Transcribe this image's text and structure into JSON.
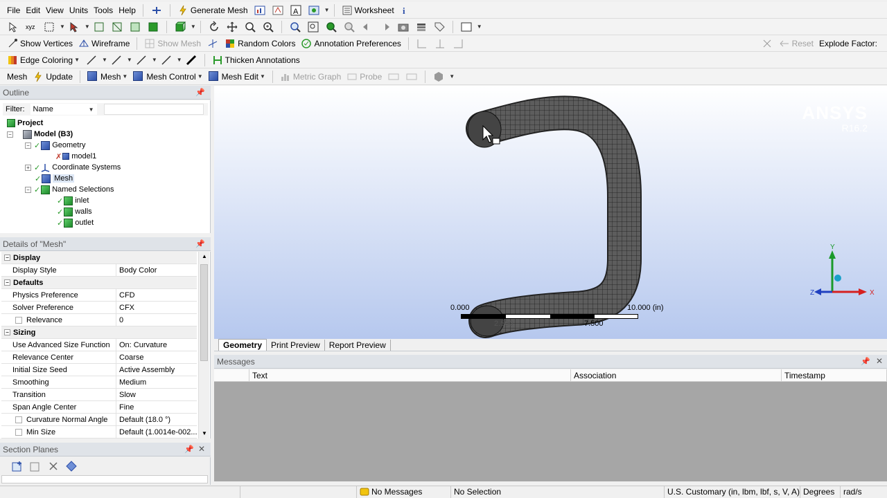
{
  "menu": {
    "items": [
      "File",
      "Edit",
      "View",
      "Units",
      "Tools",
      "Help"
    ],
    "generate_mesh": "Generate Mesh",
    "worksheet": "Worksheet"
  },
  "toolbar3": {
    "show_vertices": "Show Vertices",
    "wireframe": "Wireframe",
    "show_mesh": "Show Mesh",
    "random_colors": "Random Colors",
    "annotation_preferences": "Annotation Preferences",
    "reset": "Reset",
    "explode_factor": "Explode Factor:"
  },
  "toolbar4": {
    "edge_coloring": "Edge Coloring",
    "thicken_annotations": "Thicken Annotations"
  },
  "toolbar5": {
    "mesh": "Mesh",
    "update": "Update",
    "mesh_dd": "Mesh",
    "mesh_control": "Mesh Control",
    "mesh_edit": "Mesh Edit",
    "metric_graph": "Metric Graph",
    "probe": "Probe"
  },
  "outline": {
    "title": "Outline",
    "filter_label": "Filter:",
    "filter_value": "Name",
    "tree": {
      "project": "Project",
      "model": "Model (B3)",
      "geometry": "Geometry",
      "model1": "model1",
      "coordinate_systems": "Coordinate Systems",
      "mesh": "Mesh",
      "named_selections": "Named Selections",
      "inlet": "inlet",
      "walls": "walls",
      "outlet": "outlet"
    }
  },
  "details": {
    "title": "Details of \"Mesh\"",
    "sections": {
      "display": "Display",
      "defaults": "Defaults",
      "sizing": "Sizing"
    },
    "rows": [
      {
        "k": "Display Style",
        "v": "Body Color"
      },
      {
        "k": "Physics Preference",
        "v": "CFD"
      },
      {
        "k": "Solver Preference",
        "v": "CFX"
      },
      {
        "k": "Relevance",
        "v": "0"
      },
      {
        "k": "Use Advanced Size Function",
        "v": "On: Curvature"
      },
      {
        "k": "Relevance Center",
        "v": "Coarse"
      },
      {
        "k": "Initial Size Seed",
        "v": "Active Assembly"
      },
      {
        "k": "Smoothing",
        "v": "Medium"
      },
      {
        "k": "Transition",
        "v": "Slow"
      },
      {
        "k": "Span Angle Center",
        "v": "Fine"
      },
      {
        "k": "Curvature Normal Angle",
        "v": "Default (18.0 °)"
      },
      {
        "k": "Min Size",
        "v": "Default (1.0014e-002..."
      }
    ]
  },
  "section_planes": {
    "title": "Section Planes"
  },
  "viewport": {
    "brand": "ANSYS",
    "version": "R16.2",
    "scale_start": "0.000",
    "scale_end": "10.000 (in)",
    "scale_mid1": "2.500",
    "scale_mid2": "7.500",
    "axis_y": "Y",
    "axis_x": "X",
    "axis_z": "Z"
  },
  "view_tabs": [
    "Geometry",
    "Print Preview",
    "Report Preview"
  ],
  "messages": {
    "title": "Messages",
    "columns": [
      "Text",
      "Association",
      "Timestamp"
    ]
  },
  "status": {
    "messages": "No Messages",
    "selection": "No Selection",
    "units": "U.S. Customary (in, lbm, lbf, s, V, A)",
    "degrees": "Degrees",
    "rads": "rad/s"
  }
}
